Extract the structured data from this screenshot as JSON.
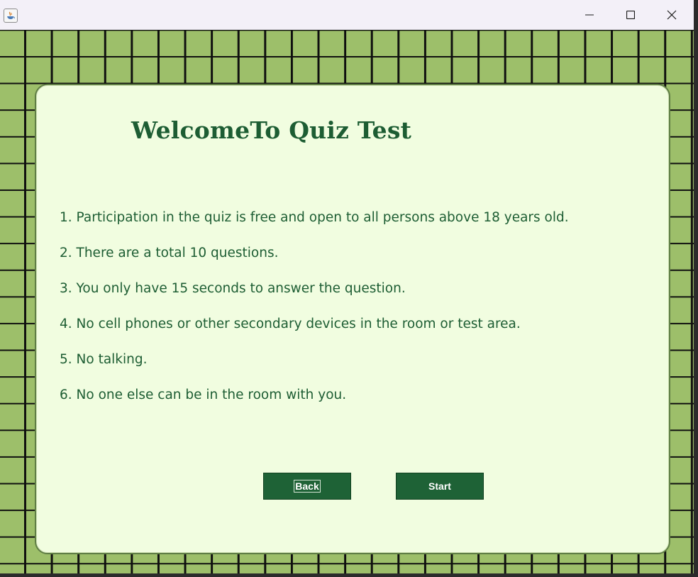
{
  "titlebar": {
    "icons": [
      "java-app-icon",
      "minimize-icon",
      "maximize-icon",
      "close-icon"
    ]
  },
  "heading": "WelcomeTo Quiz Test",
  "rules": [
    "1. Participation in the quiz is free and open to all persons above 18 years old.",
    "2. There are a total 10 questions.",
    "3. You only have 15 seconds to answer the question.",
    "4. No cell phones or other secondary devices in the room or test area.",
    "5. No talking.",
    "6. No one else can be in the room with you."
  ],
  "buttons": {
    "back": "Back",
    "start": "Start"
  },
  "colors": {
    "grid_background": "#9dbf6a",
    "grid_lines": "#0f0f0f",
    "panel_background": "#f1fde0",
    "text": "#1d5d33",
    "button": "#1e6236"
  }
}
